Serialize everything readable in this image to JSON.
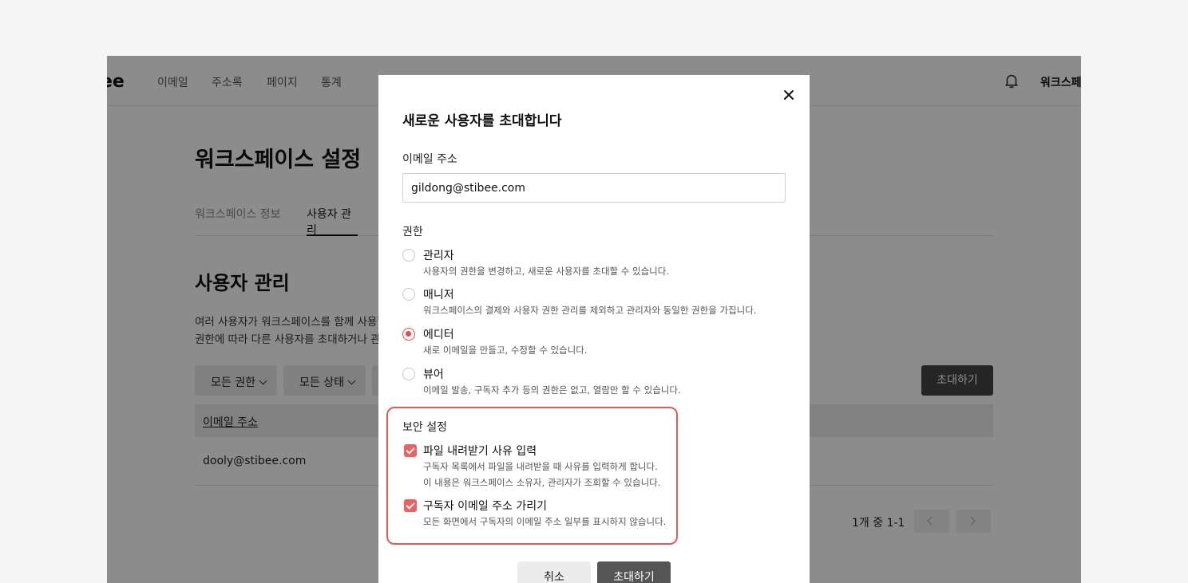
{
  "app": {
    "logo": "ee",
    "nav": [
      "이메일",
      "주소록",
      "페이지",
      "통계"
    ],
    "workspace_name": "워크스페이스"
  },
  "page": {
    "title": "워크스페이스 설정",
    "tabs": [
      "워크스페이스 정보",
      "사용자 관리"
    ],
    "active_tab": "사용자 관리",
    "section_title": "사용자 관리",
    "desc_line1": "여러 사용자가 워크스페이스를 함께 사용할",
    "desc_line2": "권한에 따라 다른 사용자를 초대하거나 관리",
    "filters": [
      "모든 권한",
      "모든 상태"
    ],
    "invite_button": "초대하기",
    "table": {
      "header_email": "이메일 주소",
      "rows": [
        "dooly@stibee.com"
      ]
    },
    "pagination": "1개 중 1-1"
  },
  "modal": {
    "title": "새로운 사용자를 초대합니다",
    "email_label": "이메일 주소",
    "email_value": "gildong@stibee.com",
    "role_label": "권한",
    "roles": [
      {
        "title": "관리자",
        "desc": "사용자의 권한을 변경하고, 새로운 사용자를 초대할 수 있습니다.",
        "selected": false
      },
      {
        "title": "매니저",
        "desc": "워크스페이스의 결제와 사용자 권한 관리를 제외하고 관리자와 동일한 권한을 가집니다.",
        "selected": false
      },
      {
        "title": "에디터",
        "desc": "새로 이메일을 만들고, 수정할 수 있습니다.",
        "selected": true
      },
      {
        "title": "뷰어",
        "desc": "이메일 발송, 구독자 추가 등의 권한은 없고, 열람만 할 수 있습니다.",
        "selected": false
      }
    ],
    "security_label": "보안 설정",
    "security_options": [
      {
        "title": "파일 내려받기 사유 입력",
        "desc1": "구독자 목록에서 파일을 내려받을 때 사유를 입력하게 합니다.",
        "desc2": "이 내용은 워크스페이스 소유자, 관리자가 조회할 수 있습니다.",
        "checked": true
      },
      {
        "title": "구독자 이메일 주소 가리기",
        "desc1": "모든 화면에서 구독자의 이메일 주소 일부를 표시하지 않습니다.",
        "checked": true
      }
    ],
    "cancel_button": "취소",
    "submit_button": "초대하기"
  },
  "colors": {
    "accent": "#e94b4b",
    "highlight_box": "#e05b5b",
    "dark_button": "#555555"
  }
}
